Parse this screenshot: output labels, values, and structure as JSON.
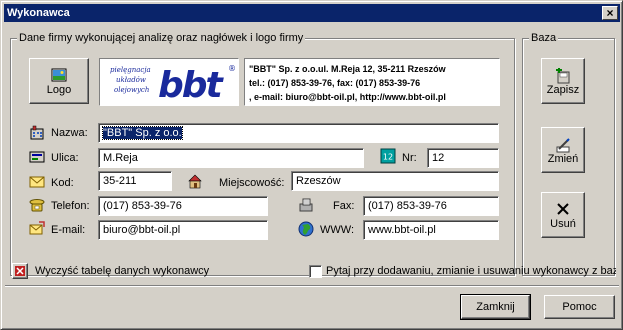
{
  "window": {
    "title": "Wykonawca",
    "close_glyph": "×"
  },
  "company_group": {
    "title": "Dane firmy wykonującej analizę oraz nagłówek i logo firmy",
    "logo_button_label": "Logo",
    "logo_image": {
      "brand_text": "bbt",
      "registered_mark": "®",
      "tagline_lines": [
        "pielęgnacja",
        "układów",
        "olejowych"
      ],
      "brand_color": "#1a2a9c"
    },
    "header_lines": [
      "\"BBT\" Sp. z o.o.ul. M.Reja  12,  35-211  Rzeszów",
      "tel.: (017) 853-39-76,   fax: (017) 853-39-76",
      ",   e-mail: biuro@bbt-oil.pl,   http://www.bbt-oil.pl"
    ],
    "fields": {
      "name": {
        "label": "Nazwa:",
        "value": "\"BBT\" Sp. z o.o."
      },
      "street": {
        "label": "Ulica:",
        "value": "M.Reja"
      },
      "number": {
        "label": "Nr:",
        "value": "12"
      },
      "postcode": {
        "label": "Kod:",
        "value": "35-211"
      },
      "city": {
        "label": "Miejscowość:",
        "value": "Rzeszów"
      },
      "phone": {
        "label": "Telefon:",
        "value": "(017) 853-39-76"
      },
      "fax": {
        "label": "Fax:",
        "value": "(017) 853-39-76"
      },
      "email": {
        "label": "E-mail:",
        "value": "biuro@bbt-oil.pl"
      },
      "www": {
        "label": "WWW:",
        "value": "www.bbt-oil.pl"
      }
    }
  },
  "base_group": {
    "title": "Baza",
    "save_label": "Zapisz",
    "change_label": "Zmień",
    "delete_label": "Usuń"
  },
  "footer": {
    "clear_table_label": "Wyczyść tabelę danych wykonawcy",
    "ask_checkbox_label": "Pytaj przy dodawaniu, zmianie i usuwaniu wykonawcy z bazy",
    "ask_checkbox_checked": false,
    "close_label": "Zamknij",
    "help_label": "Pomoc"
  }
}
